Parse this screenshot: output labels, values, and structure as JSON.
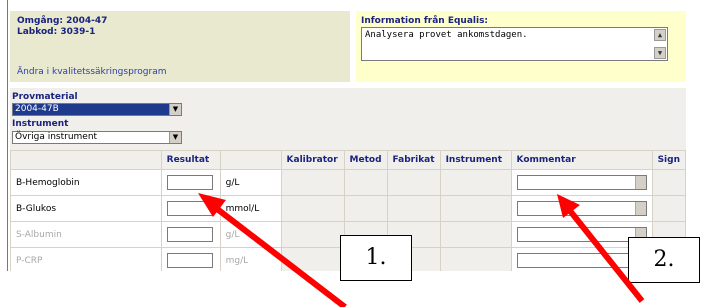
{
  "header": {
    "omgang": "Omgång: 2004-47",
    "labkod": "Labkod: 3039-1",
    "change_link": "Ändra i kvalitetssäkringsprogram",
    "info_title": "Information från Equalis:",
    "info_text": "Analysera provet ankomstdagen."
  },
  "form": {
    "provmaterial_label": "Provmaterial",
    "provmaterial_value": "2004-47B",
    "instrument_label": "Instrument",
    "instrument_value": "Övriga instrument"
  },
  "table": {
    "headers": [
      "",
      "Resultat",
      "",
      "Kalibrator",
      "Metod",
      "Fabrikat",
      "Instrument",
      "Kommentar",
      "Sign"
    ],
    "rows": [
      {
        "name": "B-Hemoglobin",
        "unit": "g/L",
        "active": true
      },
      {
        "name": "B-Glukos",
        "unit": "mmol/L",
        "active": true
      },
      {
        "name": "S-Albumin",
        "unit": "g/L",
        "active": false
      },
      {
        "name": "P-CRP",
        "unit": "mg/L",
        "active": false
      }
    ]
  },
  "annotations": {
    "callout_1": "1.",
    "callout_2": "2.",
    "arrow_color": "#ff0000"
  }
}
